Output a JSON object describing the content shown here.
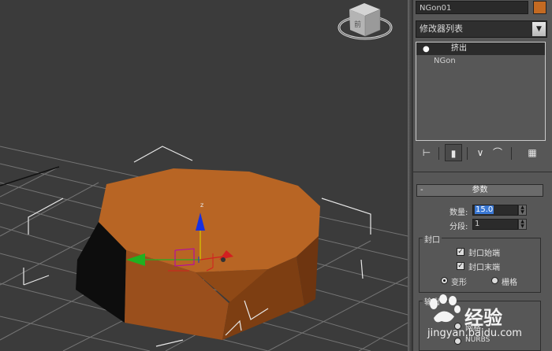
{
  "panel": {
    "object_name": "NGon01",
    "object_color": "#c46a22",
    "modifier_list_label": "修改器列表",
    "stack": [
      {
        "label": "挤出",
        "selected": true
      },
      {
        "label": "NGon",
        "selected": false
      }
    ]
  },
  "params": {
    "title": "参数",
    "amount_label": "数量:",
    "amount_value": "15.0",
    "segments_label": "分段:",
    "segments_value": "1",
    "capping_group": "封口",
    "cap_start": "封口始端",
    "cap_end": "封口末端",
    "morph": "变形",
    "grid": "栅格",
    "output_group": "输出",
    "output_option": "网格",
    "nurbs": "NURBS"
  },
  "viewport": {
    "viewcube_label": "前",
    "axis_z_label": "z"
  },
  "watermark": {
    "brand": "经验",
    "site": "jingyan.baidu.com"
  }
}
